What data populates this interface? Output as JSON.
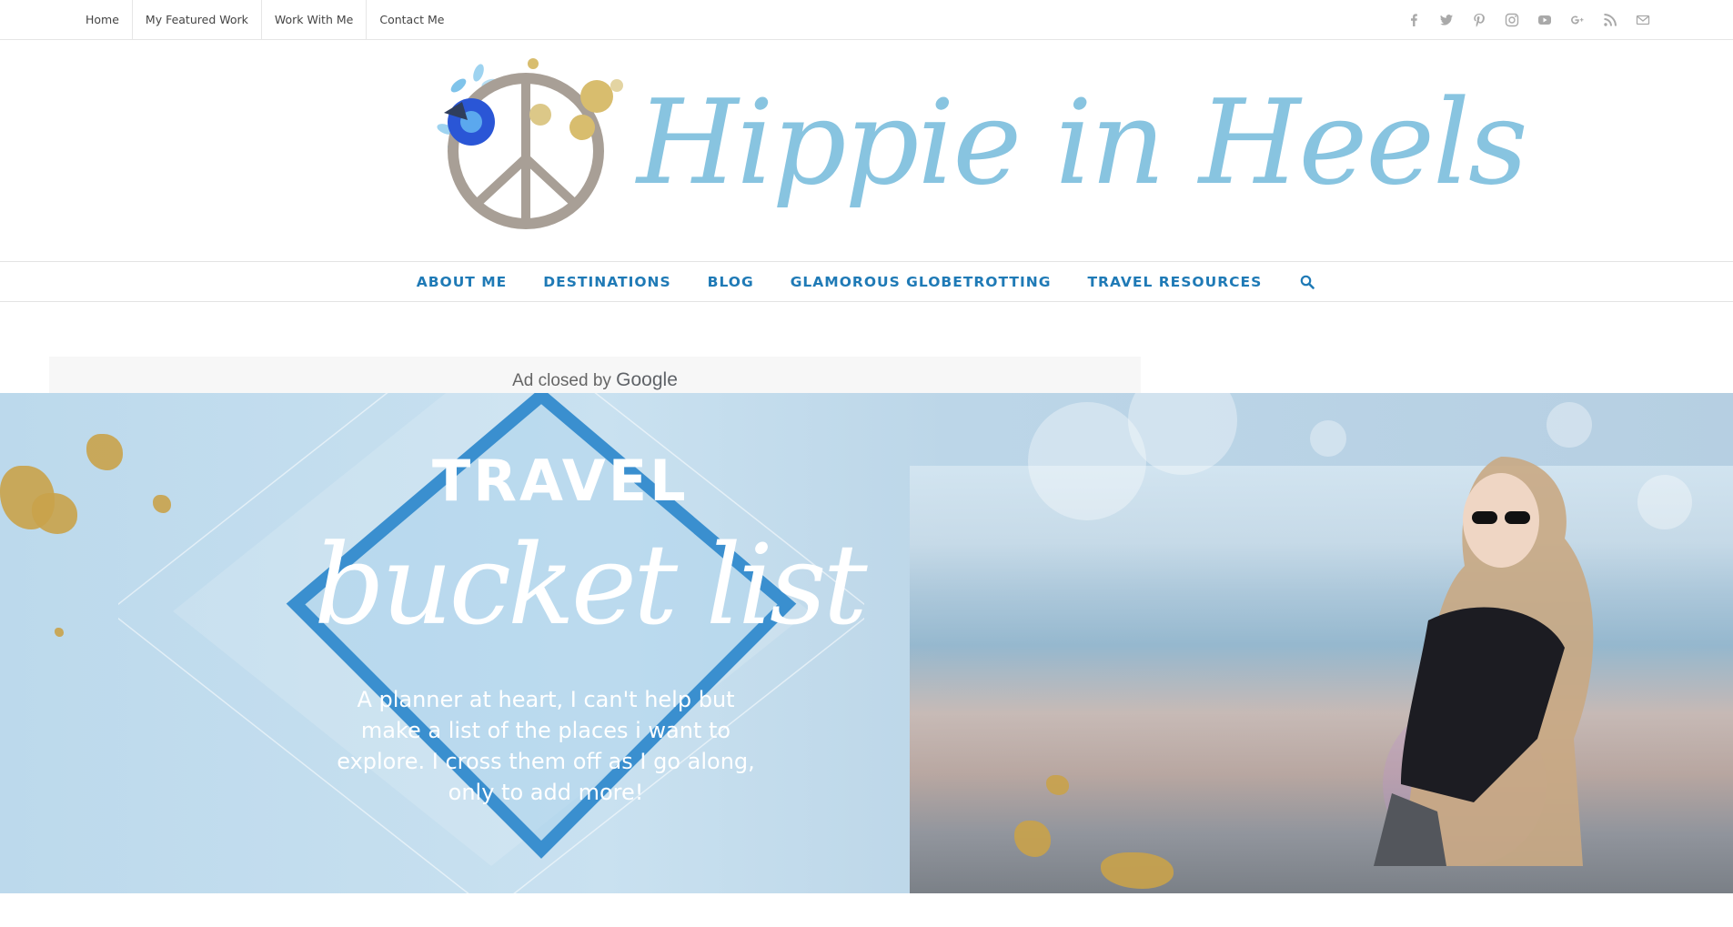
{
  "top_menu": {
    "items": [
      {
        "label": "Home"
      },
      {
        "label": "My Featured Work"
      },
      {
        "label": "Work With Me"
      },
      {
        "label": "Contact Me"
      }
    ]
  },
  "social": {
    "icons": [
      "facebook-icon",
      "twitter-icon",
      "pinterest-icon",
      "instagram-icon",
      "youtube-icon",
      "google-plus-icon",
      "rss-icon",
      "mail-icon"
    ]
  },
  "logo": {
    "text": "Hippie in Heels"
  },
  "main_nav": {
    "items": [
      {
        "label": "ABOUT ME"
      },
      {
        "label": "DESTINATIONS"
      },
      {
        "label": "BLOG"
      },
      {
        "label": "GLAMOROUS GLOBETROTTING"
      },
      {
        "label": "TRAVEL RESOURCES"
      }
    ],
    "search_icon": "search-icon"
  },
  "ad": {
    "label_prefix": "Ad closed by",
    "label_brand": "Google"
  },
  "hero": {
    "title": "TRAVEL",
    "script": "bucket list",
    "subtitle": "A planner at heart, I can't help but make a list of the places i want to explore. I cross them off as I go along, only to add more!"
  },
  "colors": {
    "accent": "#1f7ab6",
    "logo": "#88c4e0",
    "social_icon": "#a9a9a9",
    "gold": "#c9a24a"
  }
}
